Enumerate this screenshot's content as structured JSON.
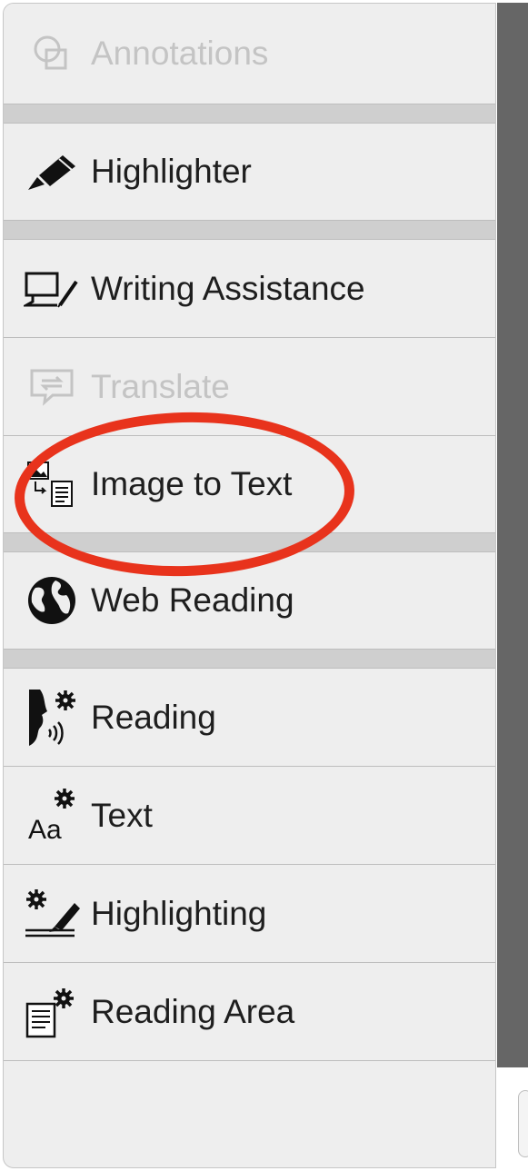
{
  "menu": {
    "items": [
      {
        "label": "Annotations",
        "icon": "annotations-icon",
        "disabled": true
      },
      {
        "label": "Highlighter",
        "icon": "highlighter-pen-icon",
        "disabled": false
      },
      {
        "label": "Writing Assistance",
        "icon": "writing-assistance-icon",
        "disabled": false
      },
      {
        "label": "Translate",
        "icon": "translate-icon",
        "disabled": true
      },
      {
        "label": "Image to Text",
        "icon": "image-to-text-icon",
        "disabled": false
      },
      {
        "label": "Web Reading",
        "icon": "globe-icon",
        "disabled": false
      },
      {
        "label": "Reading",
        "icon": "reading-voice-settings-icon",
        "disabled": false
      },
      {
        "label": "Text",
        "icon": "text-settings-icon",
        "disabled": false
      },
      {
        "label": "Highlighting",
        "icon": "highlighting-settings-icon",
        "disabled": false
      },
      {
        "label": "Reading Area",
        "icon": "reading-area-settings-icon",
        "disabled": false
      }
    ]
  },
  "colors": {
    "annotation_circle": "#e8331c",
    "right_bar": "#666666",
    "panel_bg": "#eeeeee"
  }
}
